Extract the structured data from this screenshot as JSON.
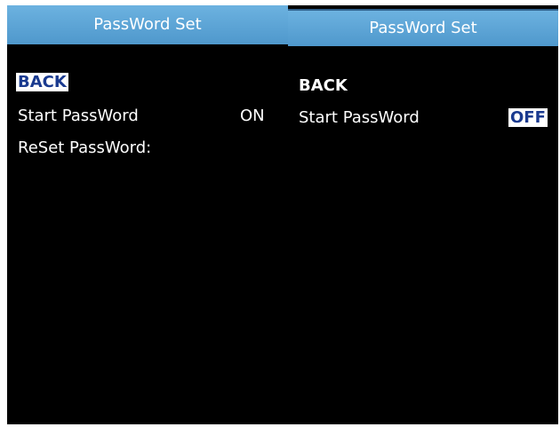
{
  "left_screen": {
    "title": "PassWord Set",
    "back_label": "BACK",
    "start_password_label": "Start PassWord",
    "start_password_value": "ON",
    "reset_password_label": "ReSet PassWord:"
  },
  "right_screen": {
    "title": "PassWord Set",
    "back_label": "BACK",
    "start_password_label": "Start PassWord",
    "start_password_value": "OFF"
  },
  "colors": {
    "title_bar": "#5fa7d7",
    "screen_background": "#000000",
    "highlight_background": "#ffffff",
    "highlight_text": "#1a3a8f"
  }
}
